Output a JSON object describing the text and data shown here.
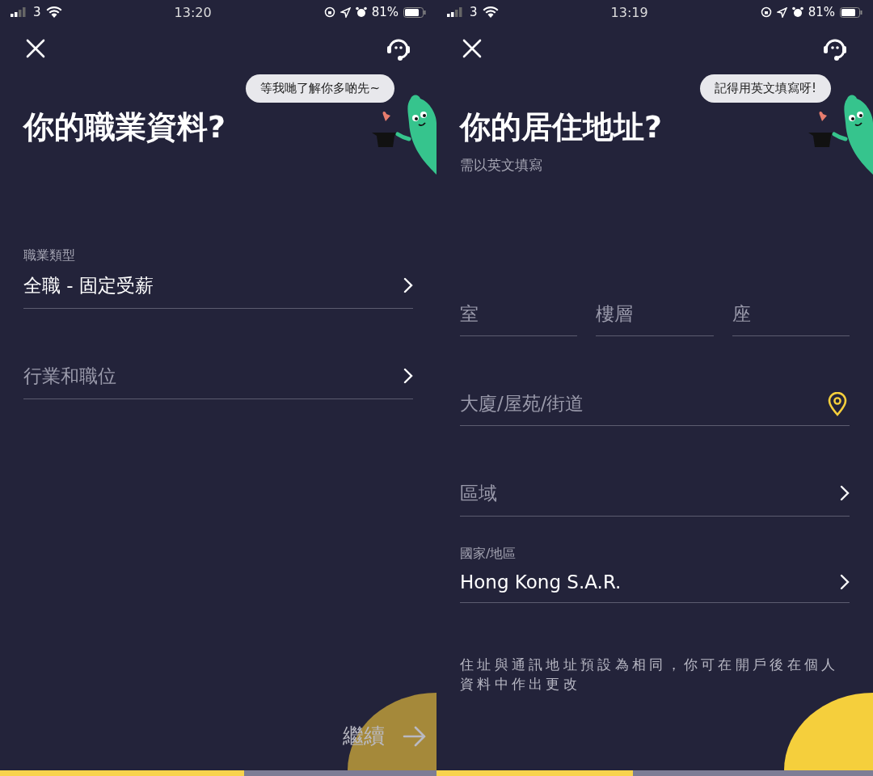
{
  "screens": [
    {
      "status_bar": {
        "carrier": "3",
        "time": "13:20",
        "battery": "81%"
      },
      "bubble": "等我哋了解你多啲先~",
      "title": "你的職業資料?",
      "rows": [
        [
          {
            "kind": "select",
            "label": "職業類型",
            "value": "全職 - 固定受薪"
          }
        ],
        [
          {
            "kind": "select",
            "placeholder": "行業和職位"
          }
        ]
      ],
      "continue_button": {
        "label": "繼續",
        "disabled": true
      },
      "progress": {
        "level": 0.56
      }
    },
    {
      "status_bar": {
        "carrier": "3",
        "time": "13:19",
        "battery": "81%"
      },
      "bubble": "記得用英文填寫呀!",
      "title": "你的居住地址?",
      "subtitle": "需以英文填寫",
      "rows": [
        [
          {
            "kind": "text",
            "placeholder": "室"
          },
          {
            "kind": "text",
            "placeholder": "樓層"
          },
          {
            "kind": "text",
            "placeholder": "座"
          }
        ],
        [
          {
            "kind": "location",
            "placeholder": "大廈/屋苑/街道"
          }
        ],
        [
          {
            "kind": "select",
            "placeholder": "區域"
          }
        ],
        [
          {
            "kind": "select",
            "label": "國家/地區",
            "value": "Hong Kong S.A.R."
          }
        ]
      ],
      "note": "住址與通訊地址預設為相同，你可在開戶後在個人資料中作出更改",
      "continue_button": {
        "disabled": false
      },
      "progress": {
        "level": 0.45
      }
    }
  ]
}
